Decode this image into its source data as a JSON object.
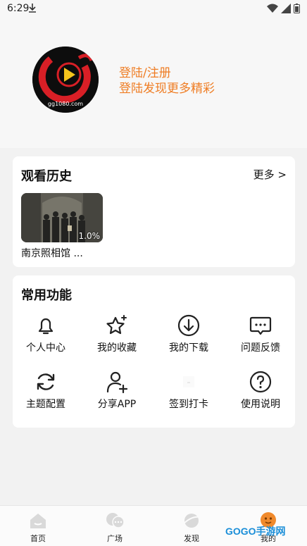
{
  "status_bar": {
    "time": "6:29"
  },
  "header": {
    "login_line1": "登陆/注册",
    "login_line2": "登陆发现更多精彩",
    "avatar_text": "gg1080.com"
  },
  "history": {
    "title": "观看历史",
    "more_label": "更多 >",
    "items": [
      {
        "title": "南京照相馆 ...",
        "progress": "1.0%"
      }
    ]
  },
  "functions": {
    "title": "常用功能",
    "items": [
      {
        "label": "个人中心",
        "icon": "bell-icon"
      },
      {
        "label": "我的收藏",
        "icon": "star-icon"
      },
      {
        "label": "我的下载",
        "icon": "download-icon"
      },
      {
        "label": "问题反馈",
        "icon": "feedback-icon"
      },
      {
        "label": "主题配置",
        "icon": "refresh-icon"
      },
      {
        "label": "分享APP",
        "icon": "share-user-icon"
      },
      {
        "label": "签到打卡",
        "icon": "checkin-icon"
      },
      {
        "label": "使用说明",
        "icon": "help-icon"
      }
    ]
  },
  "bottom_nav": {
    "items": [
      {
        "label": "首页",
        "icon": "home-icon"
      },
      {
        "label": "广场",
        "icon": "chat-icon"
      },
      {
        "label": "发现",
        "icon": "planet-icon"
      },
      {
        "label": "我的",
        "icon": "profile-icon"
      }
    ]
  },
  "watermark": "GOGO手游网",
  "colors": {
    "accent": "#ef7d24",
    "background": "#f2f2f2",
    "card": "#ffffff"
  }
}
